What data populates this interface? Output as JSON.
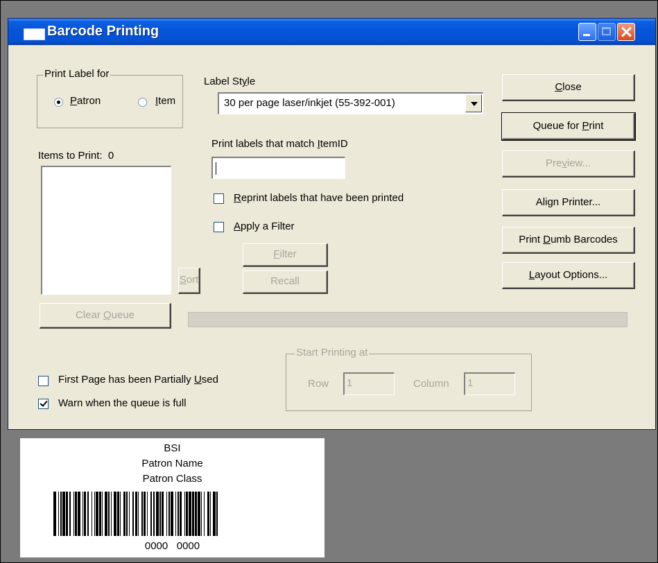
{
  "window": {
    "title": "Barcode Printing"
  },
  "print_label_for": {
    "group_title": "Print Label for",
    "options": [
      {
        "label": "Patron",
        "selected": true
      },
      {
        "label": "Item",
        "selected": false
      }
    ]
  },
  "label_style": {
    "label": "Label Style",
    "selected": "30 per page laser/inkjet (55-392-001)"
  },
  "items_to_print": {
    "label": "Items to Print:",
    "count": "0"
  },
  "match_itemid": {
    "label": "Print labels that match ItemID",
    "value": ""
  },
  "reprint_checkbox": {
    "label": "Reprint labels that have been printed",
    "checked": false
  },
  "apply_filter_checkbox": {
    "label": "Apply a Filter",
    "checked": false
  },
  "buttons": {
    "filter": "Filter",
    "recall": "Recall",
    "sort": "Sort",
    "clear_queue": "Clear Queue",
    "close": "Close",
    "queue_for_print": "Queue for Print",
    "preview": "Preview...",
    "align_printer": "Align Printer...",
    "print_dumb_barcodes": "Print Dumb Barcodes",
    "layout_options": "Layout Options..."
  },
  "first_page_checkbox": {
    "label": "First Page has been Partially Used",
    "checked": false
  },
  "warn_checkbox": {
    "label": "Warn when the queue is full",
    "checked": true
  },
  "start_printing": {
    "group_title": "Start Printing at",
    "row_label": "Row",
    "row_value": "1",
    "column_label": "Column",
    "column_value": "1"
  },
  "label_preview": {
    "line1": "BSI",
    "line2": "Patron Name",
    "line3": "Patron Class",
    "barcode_text": "0000   0000"
  }
}
